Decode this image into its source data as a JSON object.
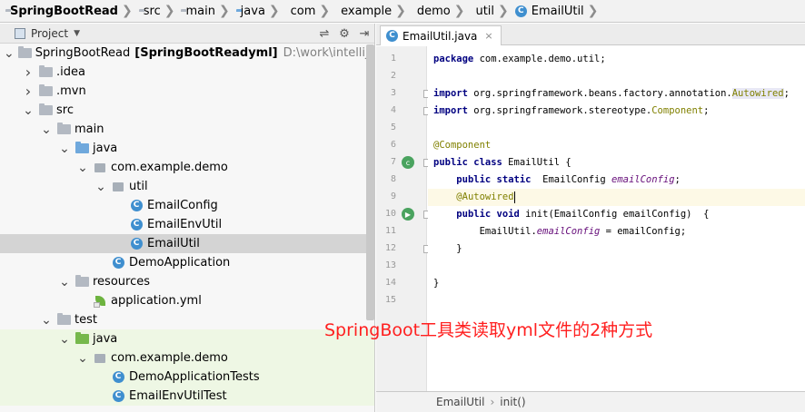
{
  "breadcrumbs": [
    {
      "label": "SpringBootRead",
      "icon": "folder-icon"
    },
    {
      "label": "src",
      "icon": "folder-icon"
    },
    {
      "label": "main",
      "icon": "folder-icon"
    },
    {
      "label": "java",
      "icon": "source-folder-icon"
    },
    {
      "label": "com",
      "icon": "package-icon"
    },
    {
      "label": "example",
      "icon": "package-icon"
    },
    {
      "label": "demo",
      "icon": "package-icon"
    },
    {
      "label": "util",
      "icon": "package-icon"
    },
    {
      "label": "EmailUtil",
      "icon": "class-icon"
    }
  ],
  "project_panel": {
    "title": "Project",
    "tools": [
      "collapse-all-icon",
      "settings-icon",
      "hide-icon"
    ]
  },
  "tree": [
    {
      "indent": 0,
      "arrow": "open",
      "icon": "folder",
      "label": "SpringBootRead",
      "bold": "[SpringBootReadyml]",
      "path": "D:\\work\\intellijmy\\Spri"
    },
    {
      "indent": 1,
      "arrow": "closed",
      "icon": "folder",
      "label": ".idea"
    },
    {
      "indent": 1,
      "arrow": "closed",
      "icon": "folder",
      "label": ".mvn"
    },
    {
      "indent": 1,
      "arrow": "open",
      "icon": "folder",
      "label": "src"
    },
    {
      "indent": 2,
      "arrow": "open",
      "icon": "folder",
      "label": "main"
    },
    {
      "indent": 3,
      "arrow": "open",
      "icon": "folder-blue",
      "label": "java"
    },
    {
      "indent": 4,
      "arrow": "open",
      "icon": "package",
      "label": "com.example.demo"
    },
    {
      "indent": 5,
      "arrow": "open",
      "icon": "package",
      "label": "util"
    },
    {
      "indent": 6,
      "arrow": "none",
      "icon": "class",
      "label": "EmailConfig"
    },
    {
      "indent": 6,
      "arrow": "none",
      "icon": "class",
      "label": "EmailEnvUtil"
    },
    {
      "indent": 6,
      "arrow": "none",
      "icon": "class",
      "label": "EmailUtil",
      "selected": true
    },
    {
      "indent": 5,
      "arrow": "none",
      "icon": "class",
      "label": "DemoApplication"
    },
    {
      "indent": 3,
      "arrow": "open",
      "icon": "folder",
      "label": "resources"
    },
    {
      "indent": 4,
      "arrow": "none",
      "icon": "yml",
      "label": "application.yml"
    },
    {
      "indent": 2,
      "arrow": "open",
      "icon": "folder",
      "label": "test"
    },
    {
      "indent": 3,
      "arrow": "open",
      "icon": "folder-green",
      "label": "java",
      "test": true
    },
    {
      "indent": 4,
      "arrow": "open",
      "icon": "package",
      "label": "com.example.demo",
      "test": true
    },
    {
      "indent": 5,
      "arrow": "none",
      "icon": "class",
      "label": "DemoApplicationTests",
      "test": true
    },
    {
      "indent": 5,
      "arrow": "none",
      "icon": "class",
      "label": "EmailEnvUtilTest",
      "test": true
    }
  ],
  "editor": {
    "tab_label": "EmailUtil.java",
    "tab_close": "×",
    "lines": [
      {
        "n": "1",
        "tokens": [
          [
            "kw",
            "package"
          ],
          [
            "t",
            " com.example.demo.util;"
          ]
        ]
      },
      {
        "n": "2",
        "tokens": []
      },
      {
        "n": "3",
        "tokens": [
          [
            "kw",
            "import"
          ],
          [
            "t",
            " org.springframework.beans.factory.annotation."
          ],
          [
            "ref-hl",
            "Autowired"
          ],
          [
            "t",
            ";"
          ]
        ]
      },
      {
        "n": "4",
        "tokens": [
          [
            "kw",
            "import"
          ],
          [
            "t",
            " org.springframework.stereotype."
          ],
          [
            "ref",
            "Component"
          ],
          [
            "t",
            ";"
          ]
        ]
      },
      {
        "n": "5",
        "tokens": []
      },
      {
        "n": "6",
        "tokens": [
          [
            "ann",
            "@Component"
          ]
        ]
      },
      {
        "n": "7",
        "tokens": [
          [
            "kw",
            "public class"
          ],
          [
            "t",
            " EmailUtil {"
          ]
        ]
      },
      {
        "n": "8",
        "tokens": [
          [
            "t",
            "    "
          ],
          [
            "kw",
            "public static"
          ],
          [
            "t",
            "  EmailConfig "
          ],
          [
            "fld",
            "emailConfig"
          ],
          [
            "t",
            ";"
          ]
        ]
      },
      {
        "n": "9",
        "tokens": [
          [
            "t",
            "    "
          ],
          [
            "ann",
            "@Autowired"
          ]
        ],
        "highlight": true,
        "caret": true
      },
      {
        "n": "10",
        "tokens": [
          [
            "t",
            "    "
          ],
          [
            "kw",
            "public void"
          ],
          [
            "t",
            " init(EmailConfig emailConfig)  {"
          ]
        ]
      },
      {
        "n": "11",
        "tokens": [
          [
            "t",
            "        EmailUtil."
          ],
          [
            "fld",
            "emailConfig"
          ],
          [
            "t",
            " = emailConfig;"
          ]
        ]
      },
      {
        "n": "12",
        "tokens": [
          [
            "t",
            "    }"
          ]
        ]
      },
      {
        "n": "13",
        "tokens": []
      },
      {
        "n": "14",
        "tokens": [
          [
            "t",
            "}"
          ]
        ]
      },
      {
        "n": "15",
        "tokens": []
      }
    ]
  },
  "status": {
    "class_name": "EmailUtil",
    "separator": "›",
    "method_name": "init()"
  },
  "overlay_text": "SpringBoot工具类读取yml文件的2种方式",
  "colors": {
    "keyword": "#000080",
    "annotation": "#808000",
    "field": "#660e7a",
    "overlay": "#ff1f1f",
    "selection": "#d4d4d4"
  }
}
